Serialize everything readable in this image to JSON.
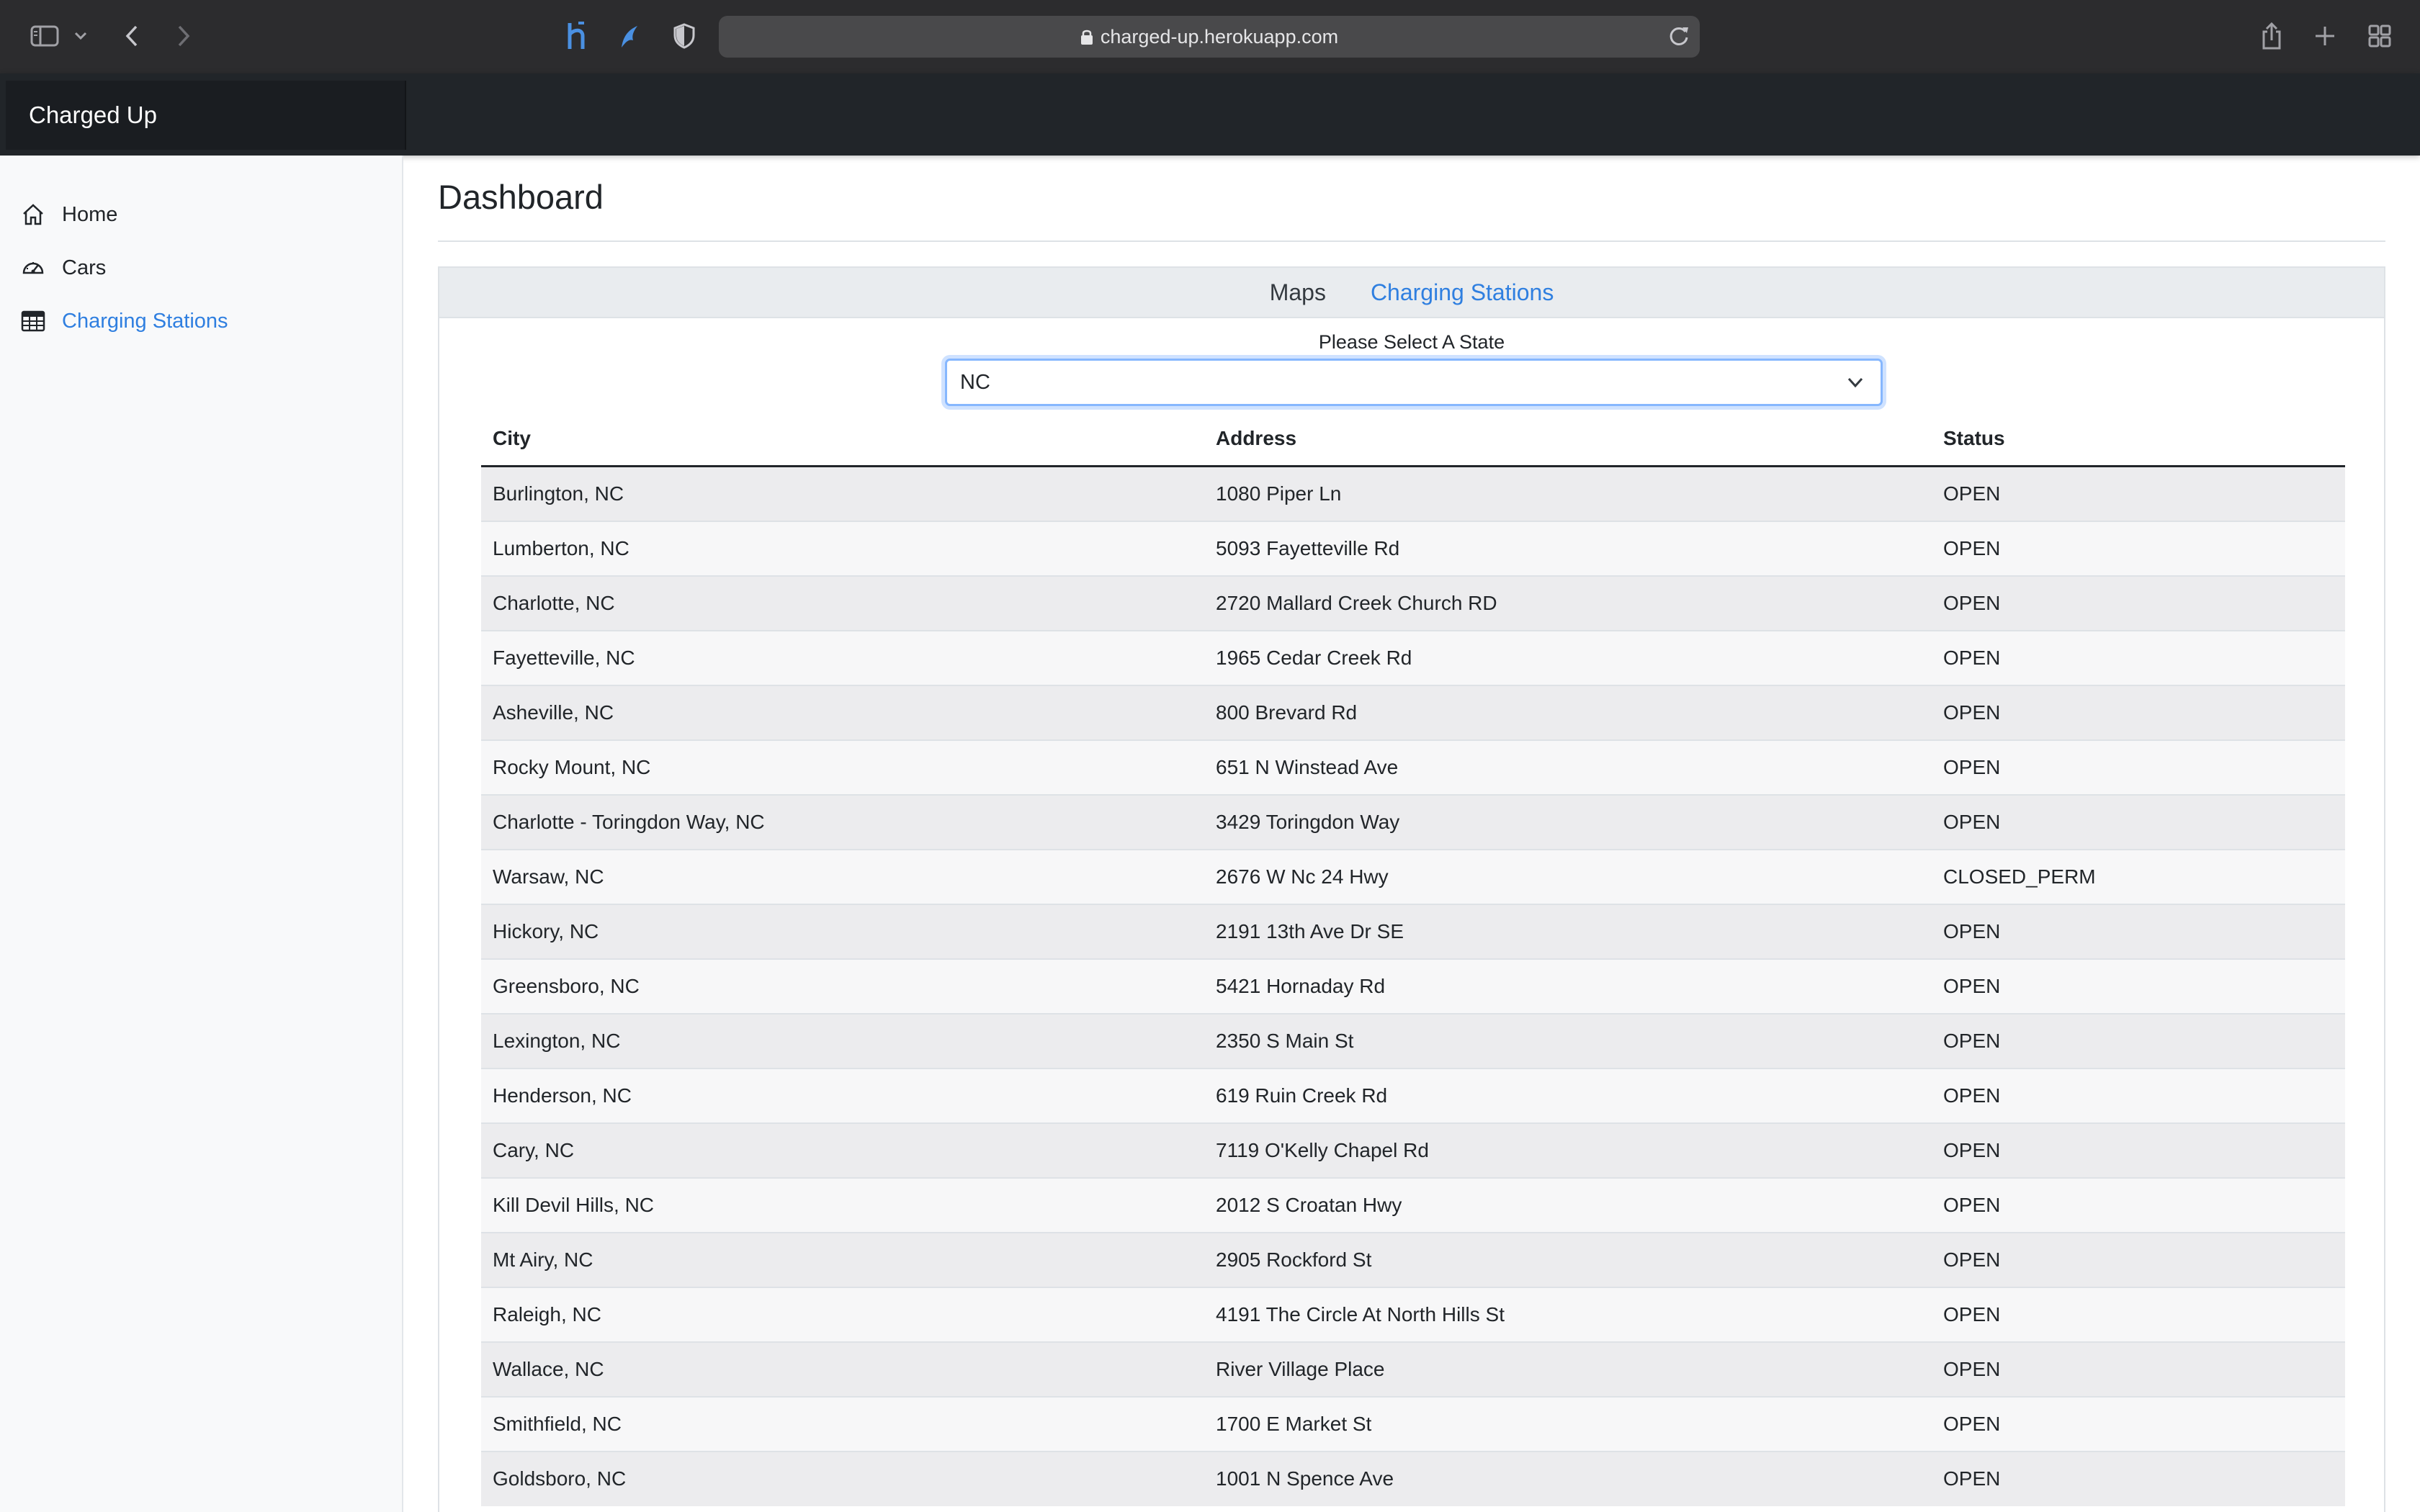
{
  "browser": {
    "url": "charged-up.herokuapp.com",
    "icons": [
      "sidebar-icon",
      "chevron-down-icon",
      "back-arrow-icon",
      "forward-arrow-icon",
      "heroku-icon",
      "extension-icon",
      "shield-icon",
      "lock-icon",
      "reload-icon",
      "share-icon",
      "new-tab-icon",
      "tab-overview-icon"
    ]
  },
  "app": {
    "brand": "Charged Up"
  },
  "sidebar": {
    "items": [
      {
        "label": "Home",
        "icon": "home-icon",
        "active": false
      },
      {
        "label": "Cars",
        "icon": "speedometer-icon",
        "active": false
      },
      {
        "label": "Charging Stations",
        "icon": "table-icon",
        "active": true
      }
    ]
  },
  "main": {
    "title": "Dashboard",
    "tabs": [
      {
        "label": "Maps",
        "active": false
      },
      {
        "label": "Charging Stations",
        "active": true
      }
    ],
    "select": {
      "label": "Please Select A State",
      "value": "NC"
    },
    "table": {
      "headers": [
        "City",
        "Address",
        "Status"
      ],
      "rows": [
        [
          "Burlington, NC",
          "1080 Piper Ln",
          "OPEN"
        ],
        [
          "Lumberton, NC",
          "5093 Fayetteville Rd",
          "OPEN"
        ],
        [
          "Charlotte, NC",
          "2720 Mallard Creek Church RD",
          "OPEN"
        ],
        [
          "Fayetteville, NC",
          "1965 Cedar Creek Rd",
          "OPEN"
        ],
        [
          "Asheville, NC",
          "800 Brevard Rd",
          "OPEN"
        ],
        [
          "Rocky Mount, NC",
          "651 N Winstead Ave",
          "OPEN"
        ],
        [
          "Charlotte - Toringdon Way, NC",
          "3429 Toringdon Way",
          "OPEN"
        ],
        [
          "Warsaw, NC",
          "2676 W Nc 24 Hwy",
          "CLOSED_PERM"
        ],
        [
          "Hickory, NC",
          "2191 13th Ave Dr SE",
          "OPEN"
        ],
        [
          "Greensboro, NC",
          "5421 Hornaday Rd",
          "OPEN"
        ],
        [
          "Lexington, NC",
          "2350 S Main St",
          "OPEN"
        ],
        [
          "Henderson, NC",
          "619 Ruin Creek Rd",
          "OPEN"
        ],
        [
          "Cary, NC",
          "7119 O'Kelly Chapel Rd",
          "OPEN"
        ],
        [
          "Kill Devil Hills, NC",
          "2012 S Croatan Hwy",
          "OPEN"
        ],
        [
          "Mt Airy, NC",
          "2905 Rockford St",
          "OPEN"
        ],
        [
          "Raleigh, NC",
          "4191 The Circle At North Hills St",
          "OPEN"
        ],
        [
          "Wallace, NC",
          "River Village Place",
          "OPEN"
        ],
        [
          "Smithfield, NC",
          "1700 E Market St",
          "OPEN"
        ],
        [
          "Goldsboro, NC",
          "1001 N Spence Ave",
          "OPEN"
        ]
      ]
    }
  },
  "colors": {
    "accent": "#2f7fe0",
    "navbar": "#212529",
    "browser_chrome": "#2c2c2e"
  }
}
